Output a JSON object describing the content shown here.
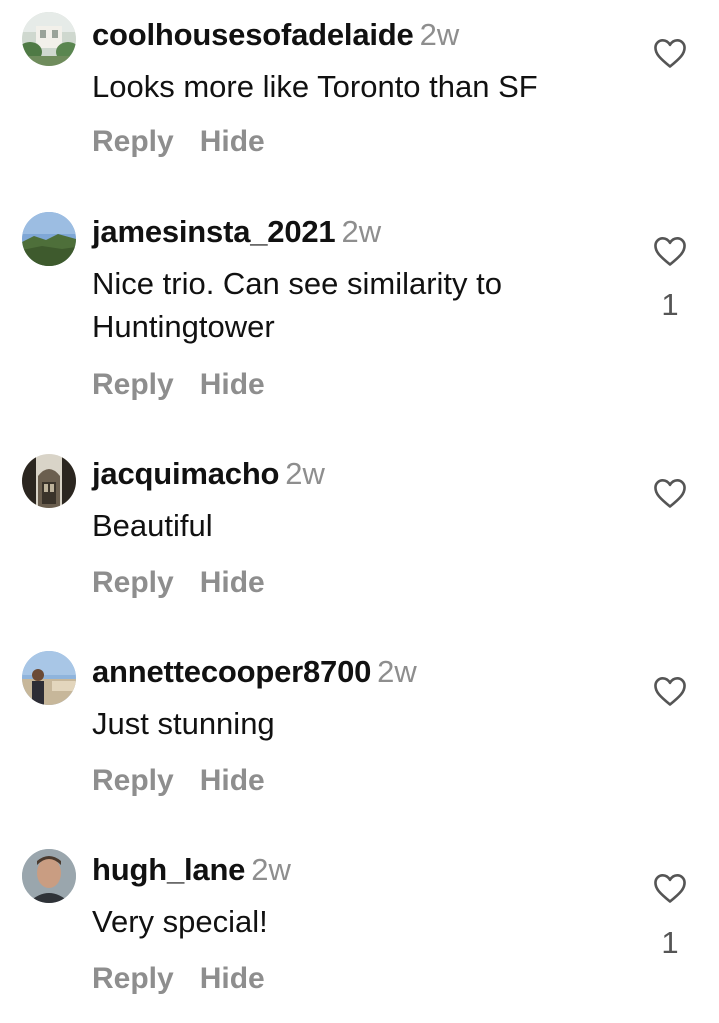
{
  "comments": [
    {
      "username": "coolhousesofadelaide",
      "time": "2w",
      "text": "Looks more like Toronto than SF",
      "reply_label": "Reply",
      "hide_label": "Hide",
      "likes": ""
    },
    {
      "username": "jamesinsta_2021",
      "time": "2w",
      "text": "Nice trio. Can see similarity to Huntingtower",
      "reply_label": "Reply",
      "hide_label": "Hide",
      "likes": "1"
    },
    {
      "username": "jacquimacho",
      "time": "2w",
      "text": "Beautiful",
      "reply_label": "Reply",
      "hide_label": "Hide",
      "likes": ""
    },
    {
      "username": "annettecooper8700",
      "time": "2w",
      "text": "Just stunning",
      "reply_label": "Reply",
      "hide_label": "Hide",
      "likes": ""
    },
    {
      "username": "hugh_lane",
      "time": "2w",
      "text": "Very special!",
      "reply_label": "Reply",
      "hide_label": "Hide",
      "likes": "1"
    }
  ],
  "icons": {
    "like": "heart-outline-icon"
  },
  "colors": {
    "text": "#111111",
    "secondary": "#8e8e8e",
    "background": "#ffffff"
  }
}
